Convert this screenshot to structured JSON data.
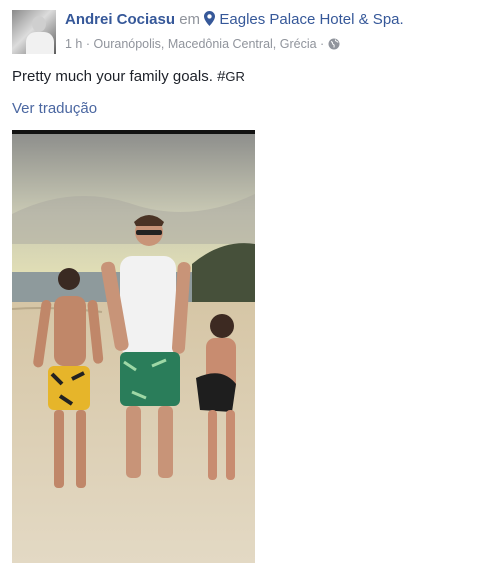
{
  "post": {
    "author": "Andrei Cociasu",
    "connector": "em",
    "location_icon": "map-pin-icon",
    "place": "Eagles Palace Hotel & Spa.",
    "time": "1 h",
    "separator": "·",
    "location_detail": "Ouranópolis, Macedônia Central, Grécia",
    "separator2": "·",
    "privacy_icon": "globe-icon",
    "text": "Pretty much your family goals. #",
    "hashtag": "GR",
    "translate_link": "Ver tradução"
  },
  "colors": {
    "link": "#365899",
    "meta": "#90949c",
    "text": "#1d2129"
  }
}
